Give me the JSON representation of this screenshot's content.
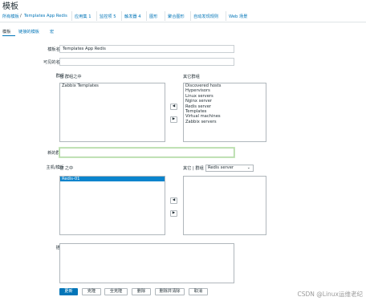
{
  "page": {
    "title": "模板"
  },
  "breadcrumbs": {
    "all_templates": "所有模板",
    "current": "Templates App Redis",
    "links": [
      "应用集",
      "监控项",
      "触发器",
      "图形",
      "聚合图形",
      "自动发现规则",
      "Web 场景"
    ],
    "counts": [
      "1",
      "5",
      "4",
      "",
      "",
      "",
      ""
    ]
  },
  "tabs": [
    "模板",
    "链接的模板",
    "宏"
  ],
  "form": {
    "template_name_label": "模板名称",
    "template_name_value": "Templates App Redis",
    "visible_name_label": "可见的名称",
    "visible_name_value": "",
    "groups_label": "群组",
    "in_groups_caption": "在 群组之中",
    "other_groups_caption": "其它群组",
    "in_groups": [
      "Zabbix Templates"
    ],
    "other_groups": [
      "Discovered hosts",
      "Hypervisors",
      "Linux servers",
      "Nginx server",
      "Redis server",
      "Templates",
      "Virtual machines",
      "Zabbix servers"
    ],
    "new_group_label": "新的群组",
    "new_group_value": "",
    "hosts_label": "主机/模板",
    "in_hosts_caption": "在 之中",
    "other_hosts_caption": "其它 | 群组",
    "hosts_group_select": "Redis server",
    "in_hosts": [
      "Redis-01"
    ],
    "other_hosts": [],
    "description_label": "描述",
    "description_value": ""
  },
  "arrows": {
    "left": "◀",
    "right": "▶"
  },
  "buttons": {
    "update": "更新",
    "clone": "克隆",
    "full_clone": "全克隆",
    "delete": "删除",
    "delete_and_clear": "删除并清除",
    "cancel": "取消"
  },
  "watermark": "CSDN @Linux运维老纪",
  "colors": {
    "accent": "#0275b8",
    "selected_row": "#0a84cd",
    "focus_border": "#b5d8a9"
  }
}
